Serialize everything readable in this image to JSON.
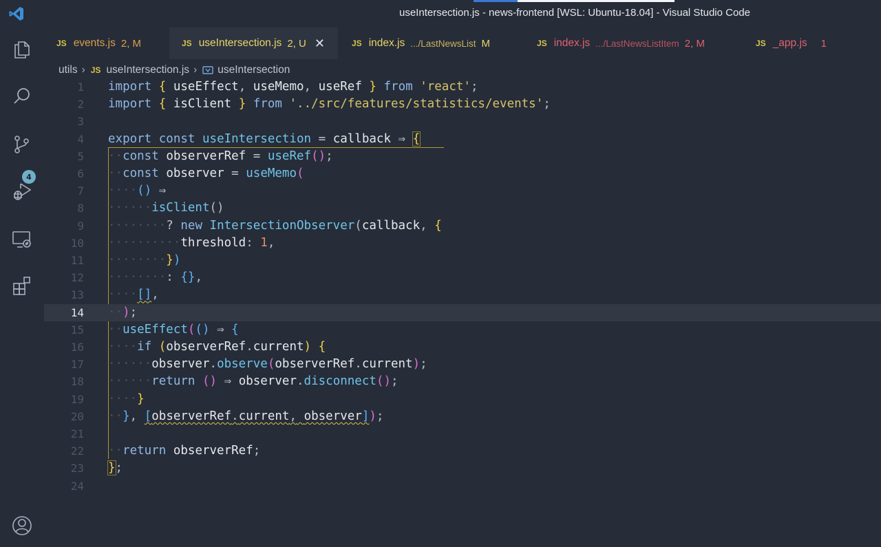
{
  "window": {
    "title": "useIntersection.js - news-frontend [WSL: Ubuntu-18.04] - Visual Studio Code"
  },
  "activity_bar": {
    "items": [
      {
        "icon": "files-icon"
      },
      {
        "icon": "search-icon"
      },
      {
        "icon": "source-control-icon",
        "badge": "4"
      },
      {
        "icon": "run-debug-icon"
      },
      {
        "icon": "remote-explorer-icon"
      },
      {
        "icon": "extensions-icon"
      },
      {
        "icon": "account-icon"
      }
    ]
  },
  "tabs": [
    {
      "lang": "JS",
      "name": "events.js",
      "path": "",
      "status": "2, M",
      "name_color": "#d9a04a",
      "status_color": "#d9a04a",
      "active": false
    },
    {
      "lang": "JS",
      "name": "useIntersection.js",
      "path": "",
      "status": "2, U",
      "name_color": "#e9d56a",
      "status_color": "#e9d56a",
      "active": true
    },
    {
      "lang": "JS",
      "name": "index.js",
      "path": ".../LastNewsList",
      "status": "M",
      "name_color": "#e9d56a",
      "status_color": "#e9d56a",
      "active": false
    },
    {
      "lang": "JS",
      "name": "index.js",
      "path": ".../LastNewsListItem",
      "status": "2, M",
      "name_color": "#e0616f",
      "status_color": "#e0616f",
      "active": false
    },
    {
      "lang": "JS",
      "name": "_app.js",
      "path": "",
      "status": "1",
      "name_color": "#e0616f",
      "status_color": "#e0616f",
      "active": false
    }
  ],
  "breadcrumb": {
    "folder": "utils",
    "file_lang": "JS",
    "file": "useIntersection.js",
    "symbol": "useIntersection"
  },
  "editor": {
    "current_line": 14,
    "line_numbers": [
      "1",
      "2",
      "3",
      "4",
      "5",
      "6",
      "7",
      "8",
      "9",
      "10",
      "11",
      "12",
      "13",
      "14",
      "15",
      "16",
      "17",
      "18",
      "19",
      "20",
      "21",
      "22",
      "23",
      "24"
    ]
  }
}
